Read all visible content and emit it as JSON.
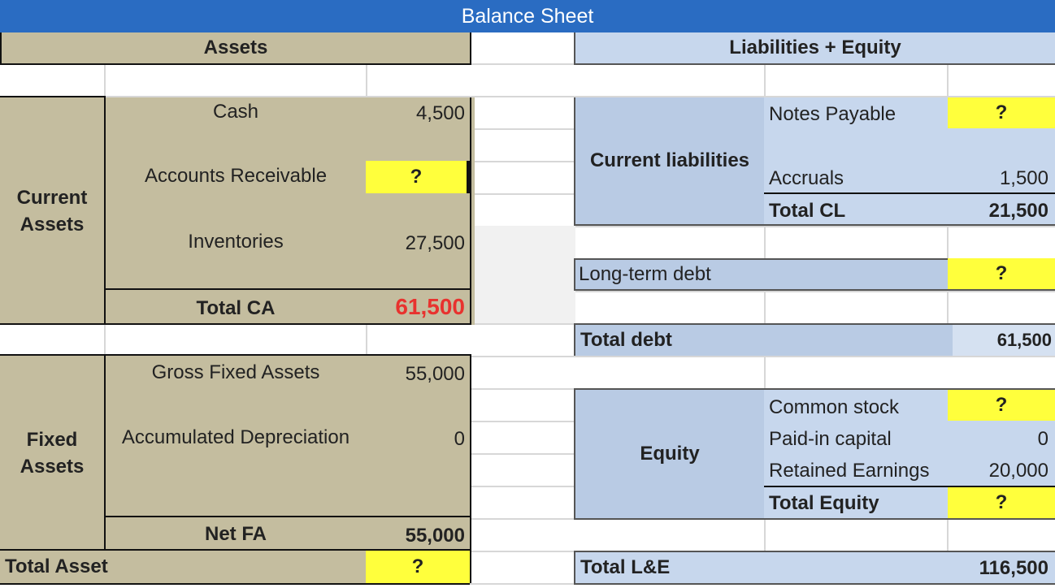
{
  "title": "Balance Sheet",
  "headers": {
    "assets": "Assets",
    "liabilities_equity": "Liabilities + Equity"
  },
  "assets": {
    "current_assets_label": "Current Assets",
    "cash_label": "Cash",
    "cash_value": "4,500",
    "ar_label": "Accounts Receivable",
    "ar_value": "?",
    "inventories_label": "Inventories",
    "inventories_value": "27,500",
    "total_ca_label": "Total CA",
    "total_ca_value": "61,500",
    "fixed_assets_label": "Fixed Assets",
    "gross_fa_label": "Gross Fixed Assets",
    "gross_fa_value": "55,000",
    "acc_dep_label": "Accumulated Depreciation",
    "acc_dep_value": "0",
    "net_fa_label": "Net FA",
    "net_fa_value": "55,000",
    "total_asset_label": "Total Asset",
    "total_asset_value": "?"
  },
  "liabilities": {
    "current_liabilities_label": "Current liabilities",
    "notes_payable_label": "Notes Payable",
    "notes_payable_value": "?",
    "accruals_label": "Accruals",
    "accruals_value": "1,500",
    "total_cl_label": "Total CL",
    "total_cl_value": "21,500",
    "ltd_label": "Long-term debt",
    "ltd_value": "?",
    "total_debt_label": "Total debt",
    "total_debt_value": "61,500"
  },
  "equity": {
    "equity_label": "Equity",
    "common_stock_label": "Common stock",
    "common_stock_value": "?",
    "paid_in_label": "Paid-in capital",
    "paid_in_value": "0",
    "retained_label": "Retained Earnings",
    "retained_value": "20,000",
    "total_equity_label": "Total Equity",
    "total_equity_value": "?",
    "total_le_label": "Total L&E",
    "total_le_value": "116,500"
  },
  "colors": {
    "title_bar": "#2a6cc2",
    "tan": "#c4bd9f",
    "blue": "#c7d7ed",
    "highlight": "#ffff3c",
    "red_total": "#e8322e"
  }
}
